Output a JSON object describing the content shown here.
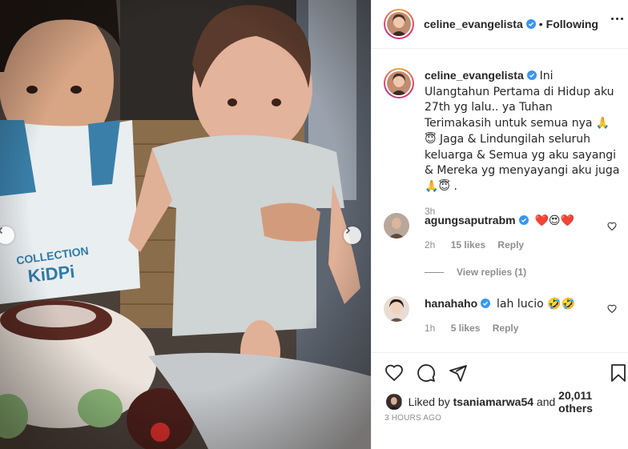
{
  "post": {
    "username": "celine_evangelista",
    "follow_status": "Following",
    "separator": "•",
    "caption_username": "celine_evangelista",
    "caption_text": "Ini Ulangtahun Pertama di Hidup aku 27th yg lalu.. ya Tuhan Terimakasih untuk semua nya 🙏😇 Jaga & Lindungilah seluruh keluarga & Semua yg aku sayangi & Mereka yg menyayangi aku juga 🙏😇 .",
    "caption_time": "3h"
  },
  "comments": [
    {
      "username": "agungsaputrabm",
      "text": "❤️😍❤️",
      "time": "2h",
      "likes": "15 likes",
      "reply_label": "Reply"
    },
    {
      "username": "hanahaho",
      "text": "lah lucio 🤣🤣",
      "time": "1h",
      "likes": "5 likes",
      "reply_label": "Reply"
    }
  ],
  "view_replies": "View replies (1)",
  "liked_by": {
    "prefix": "Liked by ",
    "user": "tsaniamarwa54",
    "middle": " and ",
    "count": "20,011 others"
  },
  "posted_ago": "3 HOURS AGO",
  "colors": {
    "verified": "#3897f0",
    "muted": "#8e8e8e",
    "text": "#262626",
    "border": "#efefef"
  },
  "icons": [
    "chevron-left-icon",
    "chevron-right-icon",
    "heart-icon",
    "comment-icon",
    "share-icon",
    "bookmark-icon",
    "more-icon",
    "verified-icon"
  ]
}
